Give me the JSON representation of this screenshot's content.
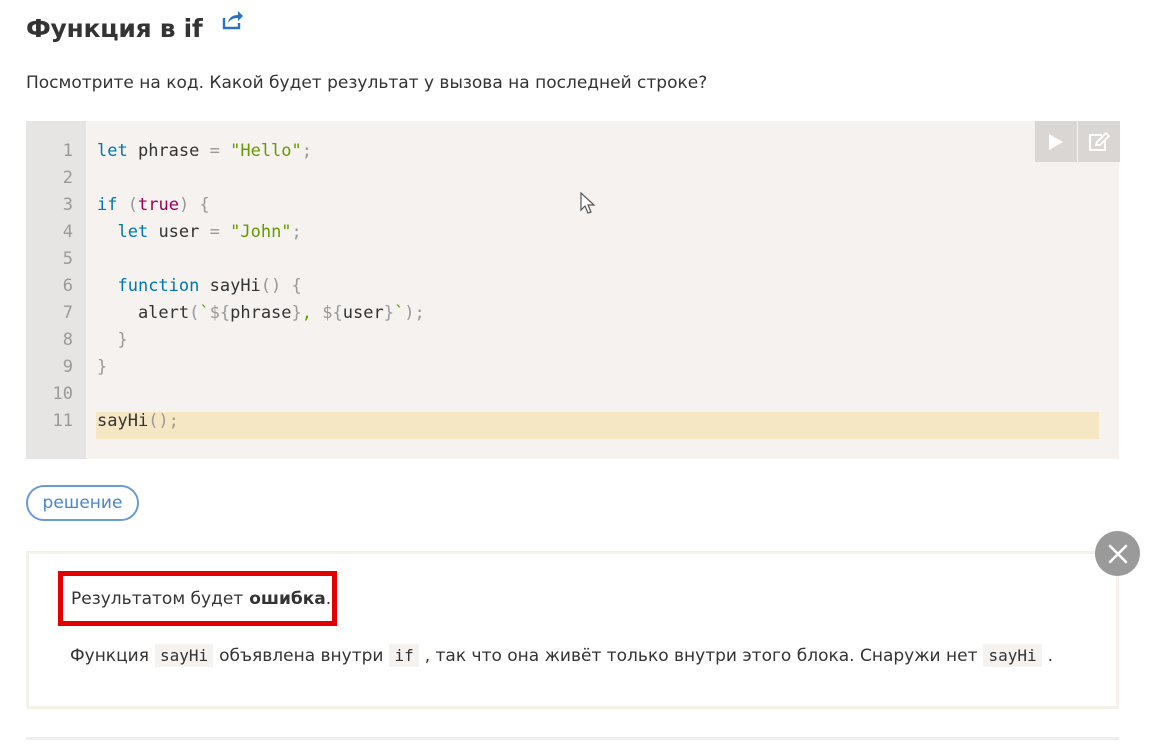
{
  "task": {
    "title": "Функция в if",
    "question": "Посмотрите на код. Какой будет результат у вызова на последней строке?"
  },
  "code": {
    "line_numbers": [
      "1",
      "2",
      "3",
      "4",
      "5",
      "6",
      "7",
      "8",
      "9",
      "10",
      "11"
    ],
    "highlighted_line": "11"
  },
  "toolbar": {
    "run_icon": "play-icon",
    "edit_icon": "edit-icon"
  },
  "solution": {
    "button_label": "решение",
    "answer_prefix": "Результатом будет",
    "answer_bold": "ошибка",
    "answer_suffix": ".",
    "explain_1": "Функция",
    "code_1": "sayHi",
    "explain_2": "объявлена внутри",
    "code_2": "if",
    "explain_3": ", так что она живёт только внутри этого блока. Снаружи нет",
    "code_3": "sayHi",
    "explain_4": "."
  },
  "colors": {
    "keyword": "#0077aa",
    "string": "#669900",
    "boolean": "#990055",
    "highlight": "#f5e6c4",
    "answer_border": "#e30000",
    "button_border": "#6b9bd0"
  }
}
